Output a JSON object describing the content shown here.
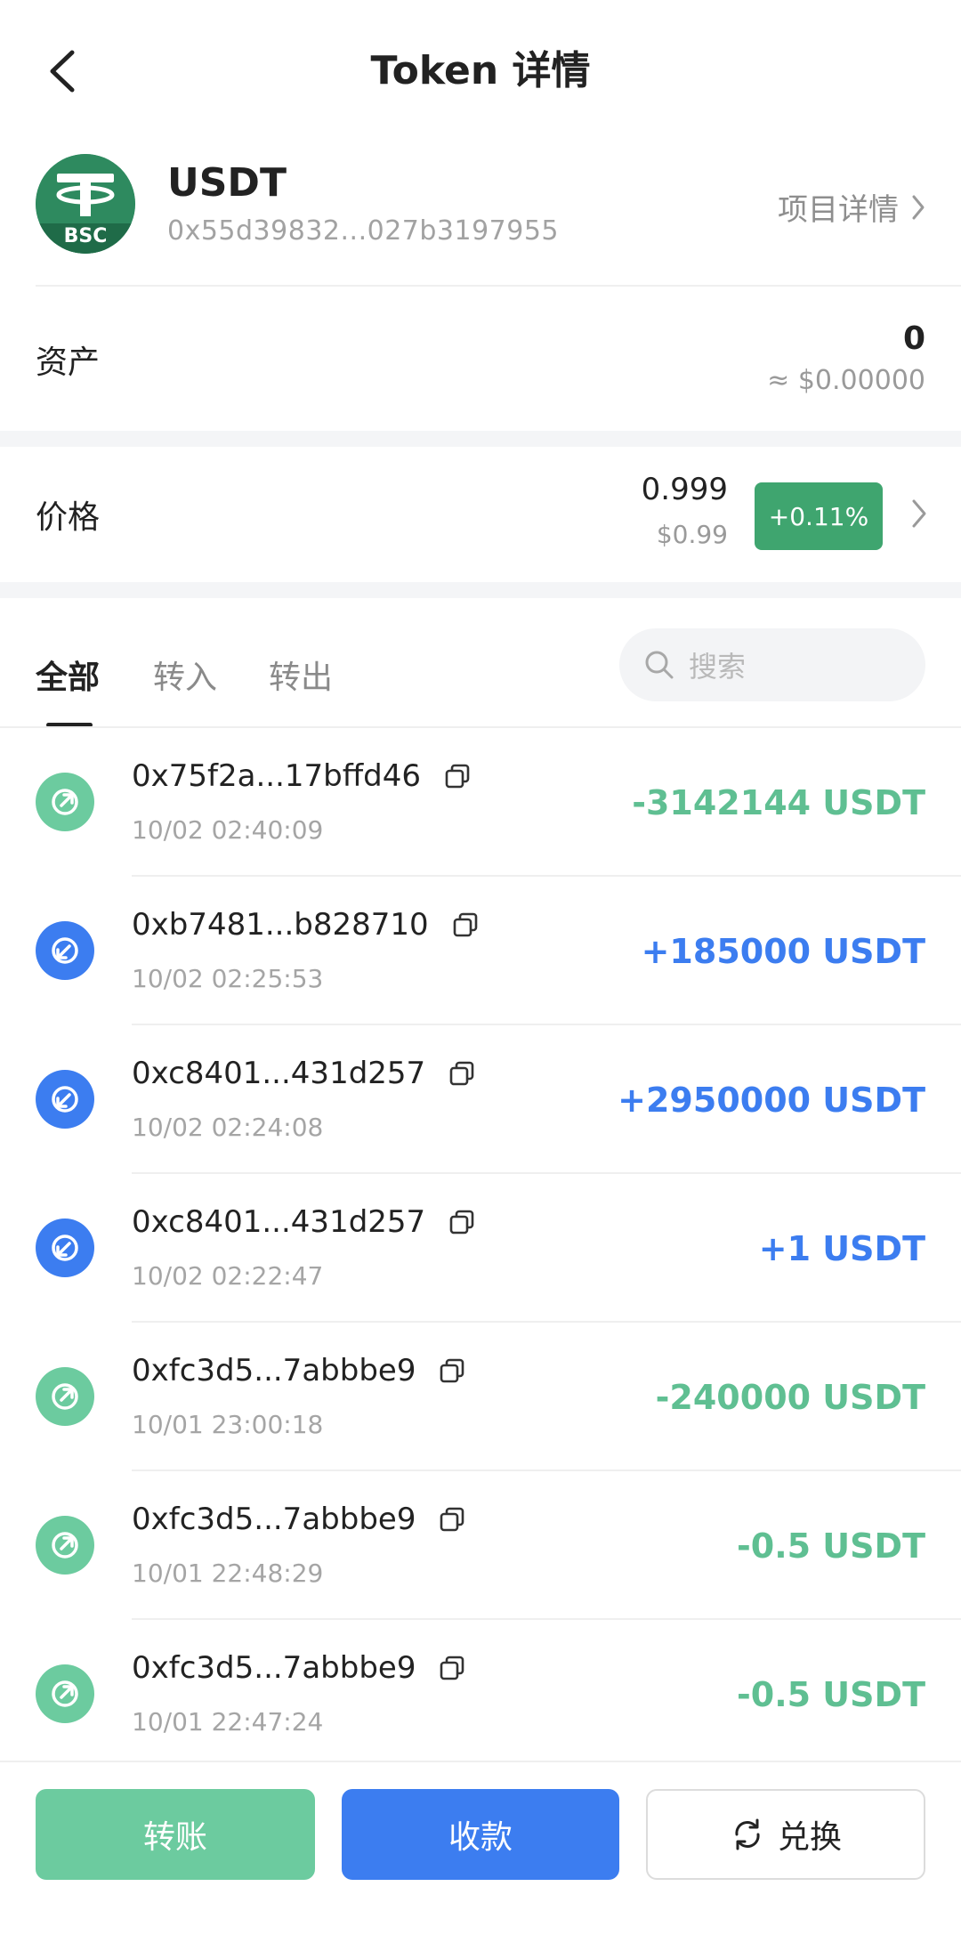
{
  "header": {
    "title": "Token 详情",
    "back_icon": "chevron-left-icon"
  },
  "token": {
    "logo_mark": "T",
    "logo_chain": "BSC",
    "name": "USDT",
    "address": "0x55d39832...027b3197955",
    "project_link_label": "项目详情"
  },
  "asset": {
    "label": "资产",
    "amount": "0",
    "usd_value": "≈ $0.00000"
  },
  "price": {
    "label": "价格",
    "value": "0.999",
    "usd_value": "$0.99",
    "change": "+0.11%",
    "change_color": "#3fa56f"
  },
  "tabs": [
    {
      "label": "全部",
      "active": true
    },
    {
      "label": "转入",
      "active": false
    },
    {
      "label": "转出",
      "active": false
    }
  ],
  "search": {
    "placeholder": "搜索"
  },
  "colors": {
    "out": "#6ccb9f",
    "in": "#3c7df0"
  },
  "transactions": [
    {
      "hash": "0x75f2a...17bffd46",
      "time": "10/02 02:40:09",
      "amount": "-3142144 USDT",
      "direction": "out"
    },
    {
      "hash": "0xb7481...b828710",
      "time": "10/02 02:25:53",
      "amount": "+185000 USDT",
      "direction": "in"
    },
    {
      "hash": "0xc8401...431d257",
      "time": "10/02 02:24:08",
      "amount": "+2950000 USDT",
      "direction": "in"
    },
    {
      "hash": "0xc8401...431d257",
      "time": "10/02 02:22:47",
      "amount": "+1 USDT",
      "direction": "in"
    },
    {
      "hash": "0xfc3d5...7abbbe9",
      "time": "10/01 23:00:18",
      "amount": "-240000 USDT",
      "direction": "out"
    },
    {
      "hash": "0xfc3d5...7abbbe9",
      "time": "10/01 22:48:29",
      "amount": "-0.5 USDT",
      "direction": "out"
    },
    {
      "hash": "0xfc3d5...7abbbe9",
      "time": "10/01 22:47:24",
      "amount": "-0.5 USDT",
      "direction": "out"
    }
  ],
  "actions": {
    "transfer_label": "转账",
    "receive_label": "收款",
    "swap_label": "兑换"
  }
}
